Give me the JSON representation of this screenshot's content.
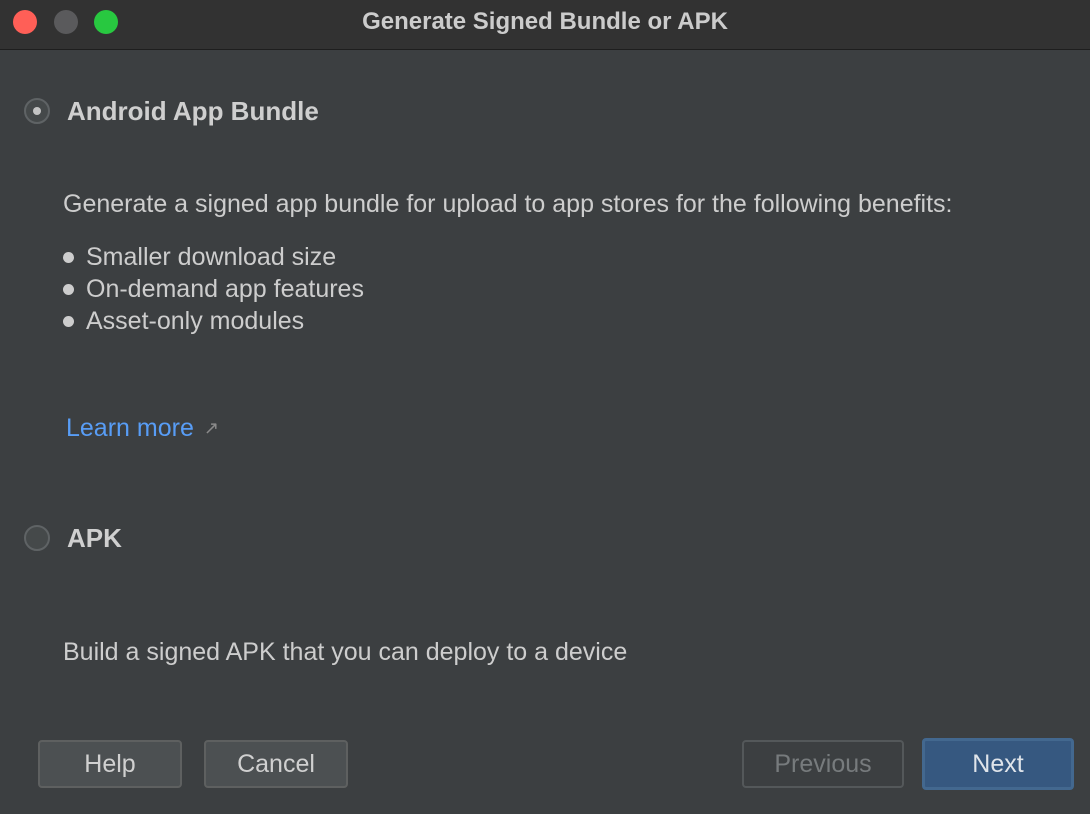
{
  "window": {
    "title": "Generate Signed Bundle or APK"
  },
  "options": {
    "bundle": {
      "label": "Android App Bundle",
      "selected": true,
      "description": "Generate a signed app bundle for upload to app stores for the following benefits:",
      "benefits": [
        "Smaller download size",
        "On-demand app features",
        "Asset-only modules"
      ],
      "learn_more": "Learn more",
      "learn_more_icon": "↗"
    },
    "apk": {
      "label": "APK",
      "selected": false,
      "description": "Build a signed APK that you can deploy to a device"
    }
  },
  "buttons": {
    "help": "Help",
    "cancel": "Cancel",
    "previous": "Previous",
    "next": "Next"
  },
  "colors": {
    "background": "#3c3f41",
    "link": "#589df6",
    "primary_button": "#365880"
  }
}
